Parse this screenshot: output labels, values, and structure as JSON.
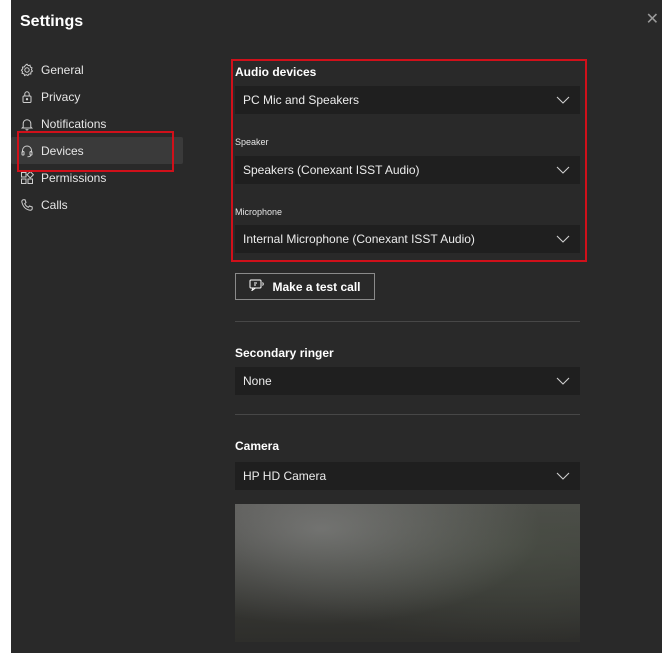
{
  "window": {
    "title": "Settings",
    "close_glyph": "✕"
  },
  "sidebar": {
    "items": [
      {
        "label": "General",
        "icon": "gear-icon",
        "active": false
      },
      {
        "label": "Privacy",
        "icon": "lock-icon",
        "active": false
      },
      {
        "label": "Notifications",
        "icon": "bell-icon",
        "active": false
      },
      {
        "label": "Devices",
        "icon": "headset-icon",
        "active": true
      },
      {
        "label": "Permissions",
        "icon": "grid-icon",
        "active": false
      },
      {
        "label": "Calls",
        "icon": "phone-icon",
        "active": false
      }
    ]
  },
  "audio": {
    "title": "Audio devices",
    "device_value": "PC Mic and Speakers",
    "speaker_label": "Speaker",
    "speaker_value": "Speakers (Conexant ISST Audio)",
    "microphone_label": "Microphone",
    "microphone_value": "Internal Microphone (Conexant ISST Audio)"
  },
  "test_call": {
    "label": "Make a test call"
  },
  "secondary_ringer": {
    "title": "Secondary ringer",
    "value": "None"
  },
  "camera": {
    "title": "Camera",
    "value": "HP HD Camera"
  },
  "colors": {
    "highlight": "#d0101a",
    "background": "#292929",
    "dropdown": "#1f1f1f"
  }
}
